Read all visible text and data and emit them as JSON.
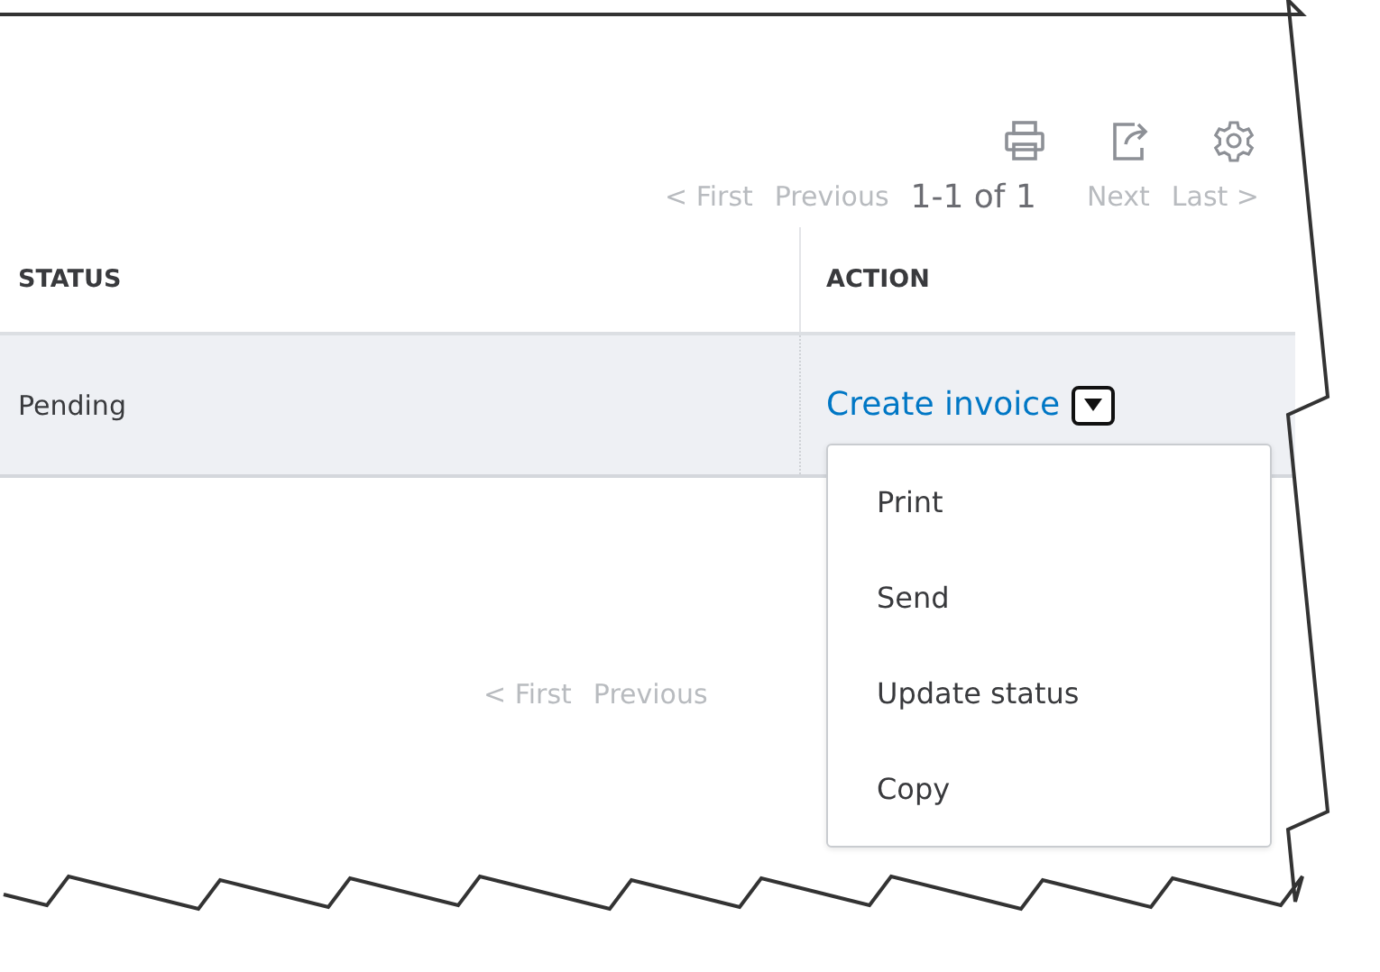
{
  "pagination_top": [
    {
      "label": "< First",
      "kind": "link",
      "disabled": true
    },
    {
      "label": "Previous",
      "kind": "link",
      "disabled": true
    },
    {
      "label": "1-1 of 1",
      "kind": "range"
    },
    {
      "label": "Next",
      "kind": "link",
      "disabled": true
    },
    {
      "label": "Last >",
      "kind": "link",
      "disabled": true
    }
  ],
  "table": {
    "columns": [
      "STATUS",
      "ACTION"
    ],
    "rows": [
      {
        "status": "Pending",
        "action": "Create invoice",
        "selected": true
      }
    ]
  },
  "action_menu": {
    "expanded": true,
    "items": [
      "Print",
      "Send",
      "Update status",
      "Copy"
    ]
  },
  "pagination_bottom": [
    {
      "label": "< First",
      "kind": "link",
      "disabled": true
    },
    {
      "label": "Previous",
      "kind": "link",
      "disabled": true
    }
  ]
}
